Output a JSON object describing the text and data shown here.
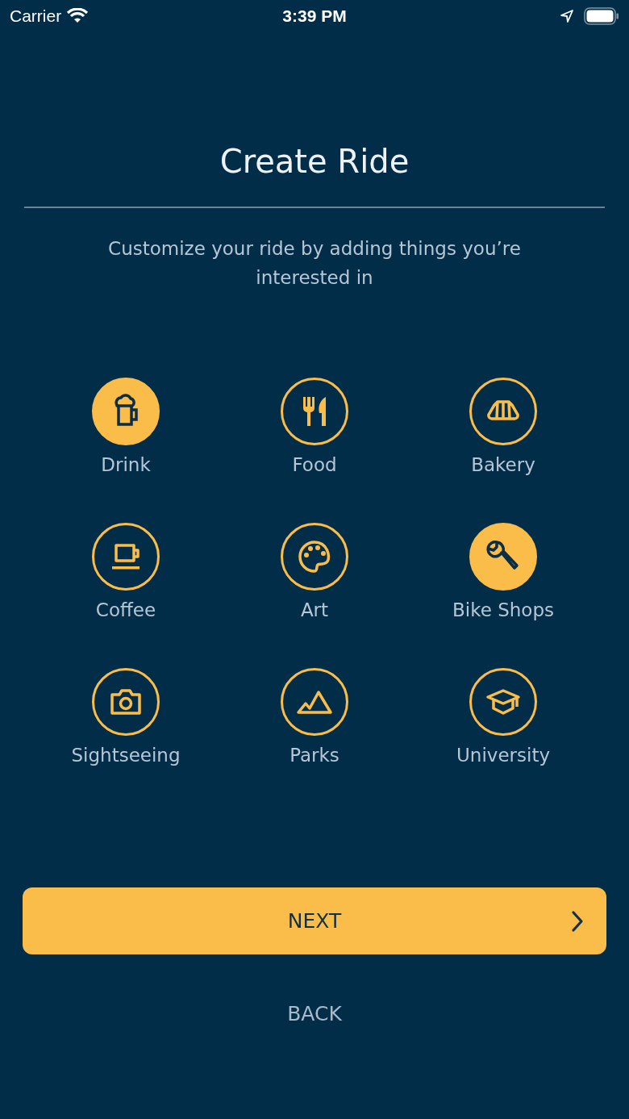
{
  "status_bar": {
    "carrier": "Carrier",
    "time": "3:39 PM"
  },
  "title": "Create Ride",
  "subtitle": "Customize your ride by adding things you’re interested in",
  "interests": [
    {
      "label": "Drink",
      "kind": "drink",
      "selected": true
    },
    {
      "label": "Food",
      "kind": "food",
      "selected": false
    },
    {
      "label": "Bakery",
      "kind": "bakery",
      "selected": false
    },
    {
      "label": "Coffee",
      "kind": "coffee",
      "selected": false
    },
    {
      "label": "Art",
      "kind": "art",
      "selected": false
    },
    {
      "label": "Bike Shops",
      "kind": "bike",
      "selected": true
    },
    {
      "label": "Sightseeing",
      "kind": "camera",
      "selected": false
    },
    {
      "label": "Parks",
      "kind": "parks",
      "selected": false
    },
    {
      "label": "University",
      "kind": "university",
      "selected": false
    }
  ],
  "next_button": "NEXT",
  "back_button": "BACK"
}
